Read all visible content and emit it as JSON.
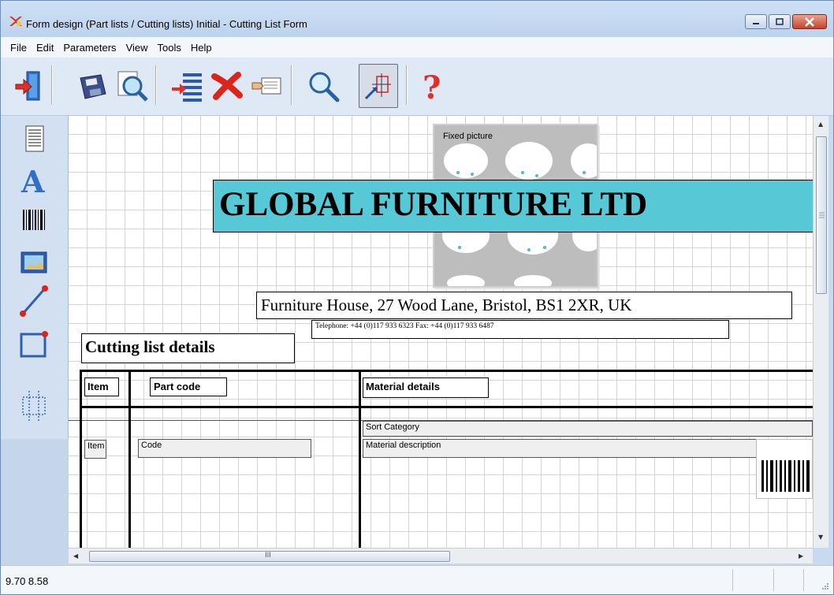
{
  "window": {
    "title": "Form design (Part lists / Cutting lists) Initial - Cutting List Form"
  },
  "menu": [
    "File",
    "Edit",
    "Parameters",
    "View",
    "Tools",
    "Help"
  ],
  "toolbar": {
    "items": [
      "exit-icon",
      "save-icon",
      "print-preview-icon",
      "insert-rows-icon",
      "delete-icon",
      "copy-icon",
      "zoom-icon",
      "select-pointer-icon",
      "help-icon"
    ],
    "active": "select-pointer-icon"
  },
  "palette": {
    "items": [
      "text-field-icon",
      "fixed-text-icon",
      "barcode-icon",
      "picture-icon",
      "line-icon",
      "rectangle-icon",
      "grid-region-icon"
    ]
  },
  "form": {
    "company_name": "GLOBAL FURNITURE LTD",
    "fixed_picture_label": "Fixed picture",
    "address": "Furniture House, 27 Wood Lane, Bristol, BS1 2XR, UK",
    "contact": "Telephone: +44 (0)117 933 6323  Fax: +44 (0)117 933 6487",
    "section_title": "Cutting list details",
    "headers": {
      "item": "Item",
      "part_code": "Part code",
      "material_details": "Material details"
    },
    "fields": {
      "sort_category": "Sort Category",
      "item": "Item",
      "code": "Code",
      "material_description": "Material description"
    }
  },
  "hscroll_grip": "III",
  "status": {
    "coords": "9.70 8.58"
  },
  "colors": {
    "banner": "#56c8d6",
    "title_bg": "#bcd3ee",
    "close_btn": "#c5432a"
  }
}
